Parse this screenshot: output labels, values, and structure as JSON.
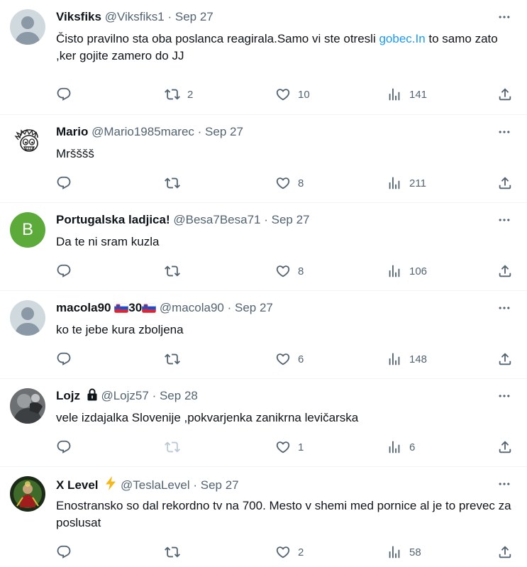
{
  "colors": {
    "accent": "#1d9bf0",
    "muted": "#536471",
    "border": "#eff3f4",
    "avatar_b": "#5cab3a"
  },
  "tweets": [
    {
      "name": "Viksfiks",
      "handle": "@Viksfiks1",
      "sep": "·",
      "date": "Sep 27",
      "text_before": "Čisto pravilno sta oba poslanca reagirala.Samo vi ste otresli ",
      "link": "gobec.In",
      "text_after": " to samo zato ,ker gojite zamero do JJ",
      "replies": "",
      "retweets": "2",
      "likes": "10",
      "views": "141"
    },
    {
      "name": "Mario",
      "handle": "@Mario1985marec",
      "sep": "·",
      "date": "Sep 27",
      "text": "Mršššš",
      "replies": "",
      "retweets": "",
      "likes": "8",
      "views": "211"
    },
    {
      "name": "Portugalska ladjica!",
      "handle": "@Besa7Besa71",
      "sep": "·",
      "date": "Sep 27",
      "avatar_letter": "B",
      "text": "Da te ni sram kuzla",
      "replies": "",
      "retweets": "",
      "likes": "8",
      "views": "106"
    },
    {
      "name_pre": "macola90 ",
      "name_mid": "30",
      "handle": "@macola90",
      "sep": "·",
      "date": "Sep 27",
      "text": "ko te jebe kura zboljena",
      "replies": "",
      "retweets": "",
      "likes": "6",
      "views": "148"
    },
    {
      "name": "Lojz",
      "handle": "@Lojz57",
      "sep": "·",
      "date": "Sep 28",
      "text": "vele izdajalka Slovenije ,pokvarjenka zanikrna levičarska",
      "replies": "",
      "retweets": "",
      "likes": "1",
      "views": "6"
    },
    {
      "name": "X Level",
      "handle": "@TeslaLevel",
      "sep": "·",
      "date": "Sep 27",
      "text": "Enostransko so dal rekordno tv na 700. Mesto v shemi med pornice al je to prevec za poslusat",
      "replies": "",
      "retweets": "",
      "likes": "2",
      "views": "58"
    }
  ]
}
